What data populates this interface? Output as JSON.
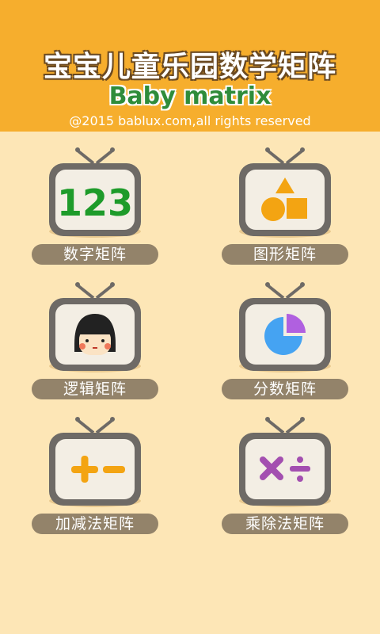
{
  "header": {
    "title_cn": "宝宝儿童乐园数学矩阵",
    "title_en": "Baby matrix",
    "copyright": "@2015 bablux.com,all rights reserved"
  },
  "tiles": [
    {
      "label": "数字矩阵",
      "icon": "numbers-123-icon"
    },
    {
      "label": "图形矩阵",
      "icon": "shapes-icon"
    },
    {
      "label": "逻辑矩阵",
      "icon": "girl-face-icon"
    },
    {
      "label": "分数矩阵",
      "icon": "pie-chart-icon"
    },
    {
      "label": "加减法矩阵",
      "icon": "plus-minus-icon"
    },
    {
      "label": "乘除法矩阵",
      "icon": "multiply-divide-icon"
    }
  ],
  "icon_text": {
    "numbers": "123"
  },
  "colors": {
    "header_bg": "#F6AE2D",
    "page_bg": "#FDE6B6",
    "tv_frame": "#6E6A66",
    "tv_screen": "#F3EEE4",
    "label_bg": "#93836A",
    "green": "#1E9B2A",
    "orange": "#F3A412",
    "blue": "#45A3F2",
    "purple": "#B060E0"
  }
}
